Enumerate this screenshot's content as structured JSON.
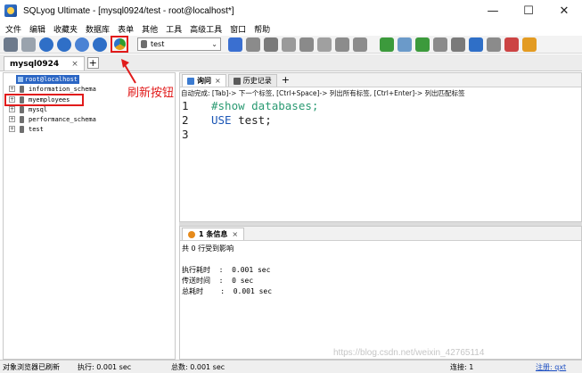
{
  "window": {
    "title": "SQLyog Ultimate - [mysql0924/test - root@localhost*]",
    "minimize": "—",
    "maximize": "☐",
    "close": "✕"
  },
  "menu": [
    "文件",
    "编辑",
    "收藏夹",
    "数据库",
    "表单",
    "其他",
    "工具",
    "高级工具",
    "窗口",
    "帮助"
  ],
  "toolbar": {
    "db_selector_value": "test",
    "colors": {
      "green": "#3c9a3c",
      "blue": "#2f6fc7",
      "orange": "#e39b22",
      "gray": "#8b8b8b"
    }
  },
  "connection_tabs": {
    "active": "mysql0924",
    "close": "×",
    "add": "+"
  },
  "object_browser": {
    "root": "root@localhost",
    "expander": "+",
    "databases": [
      "information_schema",
      "myemployees",
      "mysql",
      "performance_schema",
      "test"
    ],
    "highlighted_db": "myemployees"
  },
  "annotation": {
    "refresh_label": "刷新按钮",
    "color": "#e11b1b"
  },
  "query_editor": {
    "tabs": [
      {
        "label": "询问",
        "close": "×",
        "active": true
      },
      {
        "label": "历史记录",
        "active": false
      }
    ],
    "add_tab": "+",
    "hint": "自动完成: [Tab]-> 下一个标签, [Ctrl+Space]-> 列出所有标签, [Ctrl+Enter]-> 列出匹配标签",
    "line_numbers": [
      "1",
      "2",
      "3"
    ],
    "line1": "#show databases;",
    "line2_kw": "USE",
    "line2_rest": " test;"
  },
  "results": {
    "tab_label": "1 条信息",
    "close": "×",
    "affected": "共 0 行受到影响",
    "exec_time_label": "执行耗时",
    "exec_time_value": "  :  0.001 sec",
    "transfer_time_label": "传送时间",
    "transfer_time_value": "  :  0 sec",
    "total_time_label": "总耗时",
    "total_time_value": "    :  0.001 sec"
  },
  "statusbar": {
    "status": "对象浏览器已刷新",
    "exec": "执行: 0.001 sec",
    "total": "总数: 0.001 sec",
    "connection": "连接: 1",
    "registered": "注册: qxt"
  },
  "watermark": "https://blog.csdn.net/weixin_42765114"
}
